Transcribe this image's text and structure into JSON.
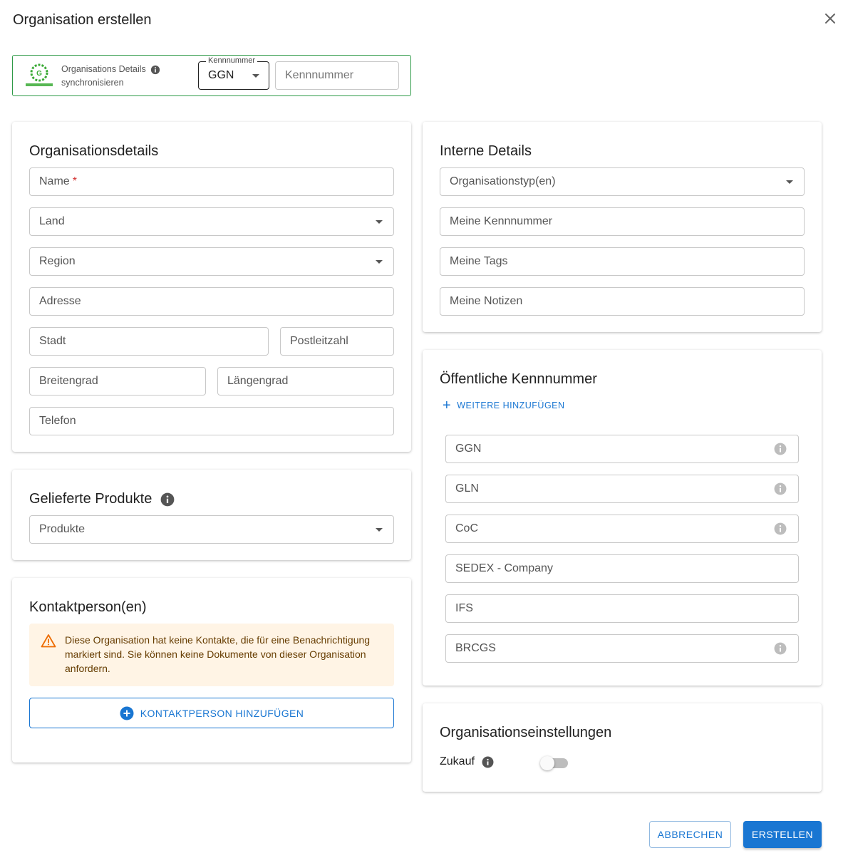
{
  "dialog": {
    "title": "Organisation erstellen",
    "close_icon": "close-icon"
  },
  "sync": {
    "logo_icon": "globalgap-logo",
    "line1": "Organisations Details",
    "line2": "synchronisieren",
    "info_icon": "info-icon",
    "kennnummer_legend": "Kennnummer",
    "kennnummer_type": "GGN",
    "kennnummer_placeholder": "Kennnummer",
    "border_color": "#2e9a47"
  },
  "org_details": {
    "title": "Organisationsdetails",
    "name": "Name",
    "name_required": "*",
    "land": "Land",
    "region": "Region",
    "adresse": "Adresse",
    "stadt": "Stadt",
    "postleitzahl": "Postleitzahl",
    "breitengrad": "Breitengrad",
    "laengengrad": "Längengrad",
    "telefon": "Telefon"
  },
  "products": {
    "title": "Gelieferte Produkte",
    "info_icon": "info-icon",
    "field": "Produkte"
  },
  "contacts": {
    "title": "Kontaktperson(en)",
    "warning_icon": "warning-triangle-icon",
    "warning": "Diese Organisation hat keine Kontakte, die für eine Benachrichtigung markiert sind. Sie können keine Dokumente von dieser Organisation anfordern.",
    "add_button": "KONTAKTPERSON HINZUFÜGEN",
    "add_icon": "plus-circle-icon"
  },
  "internal": {
    "title": "Interne Details",
    "org_types": "Organisationstyp(en)",
    "my_id": "Meine Kennnummer",
    "my_tags": "Meine Tags",
    "my_notes": "Meine Notizen"
  },
  "public_ids": {
    "title": "Öffentliche Kennnummer",
    "add_more": "WEITERE HINZUFÜGEN",
    "add_icon": "plus-icon",
    "fields": [
      {
        "label": "GGN",
        "info": true
      },
      {
        "label": "GLN",
        "info": true
      },
      {
        "label": "CoC",
        "info": true
      },
      {
        "label": "SEDEX - Company",
        "info": false
      },
      {
        "label": "IFS",
        "info": false
      },
      {
        "label": "BRCGS",
        "info": true
      }
    ]
  },
  "settings": {
    "title": "Organisationseinstellungen",
    "zukauf": "Zukauf",
    "info_icon": "info-icon",
    "zukauf_enabled": false
  },
  "actions": {
    "cancel": "ABBRECHEN",
    "create": "ERSTELLEN",
    "accent": "#1976d2"
  }
}
